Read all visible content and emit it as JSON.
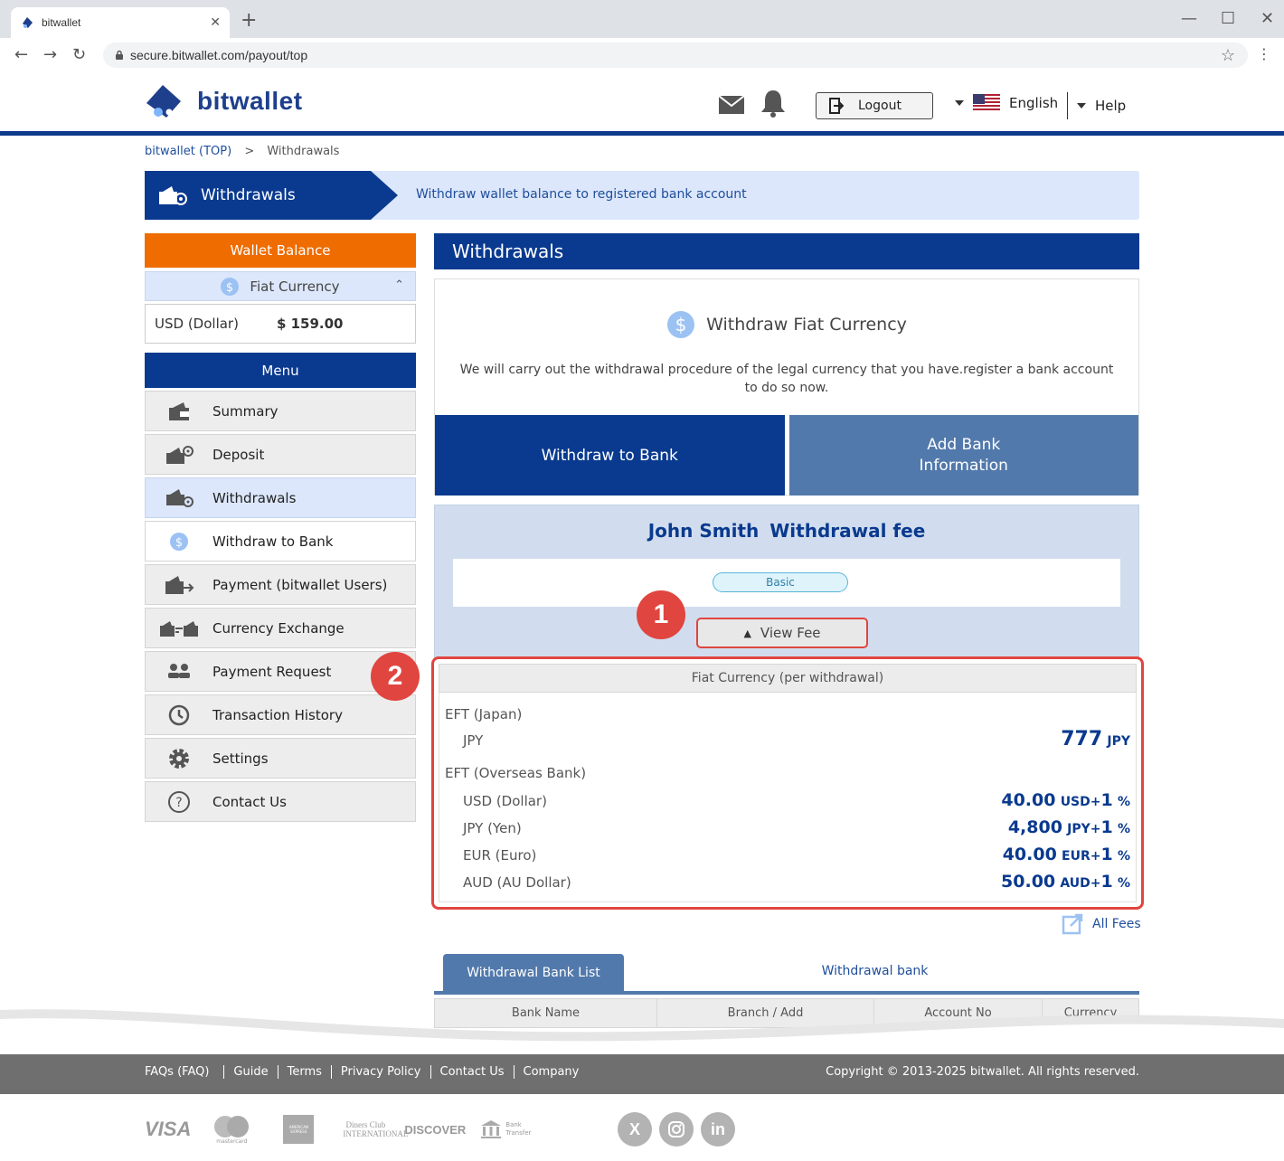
{
  "browser": {
    "tab_title": "bitwallet",
    "url": "secure.bitwallet.com/payout/top"
  },
  "header": {
    "logo_text": "bitwallet",
    "logout_label": "Logout",
    "language": "English",
    "help_label": "Help"
  },
  "breadcrumb": {
    "home": "bitwallet (TOP)",
    "separator": ">",
    "current": "Withdrawals"
  },
  "banner": {
    "label": "Withdrawals",
    "description": "Withdraw wallet balance to registered bank account"
  },
  "sidebar": {
    "wallet_balance_label": "Wallet Balance",
    "fiat_label": "Fiat Currency",
    "balance_currency": "USD (Dollar)",
    "balance_amount": "$ 159.00",
    "menu_label": "Menu",
    "items": [
      {
        "label": "Summary",
        "icon": "wallet-icon"
      },
      {
        "label": "Deposit",
        "icon": "deposit-icon"
      },
      {
        "label": "Withdrawals",
        "icon": "withdrawal-icon"
      },
      {
        "label": "Withdraw to Bank",
        "icon": "dollar-icon"
      },
      {
        "label": "Payment (bitwallet Users)",
        "icon": "payment-icon"
      },
      {
        "label": "Currency Exchange",
        "icon": "exchange-icon"
      },
      {
        "label": "Payment Request",
        "icon": "users-icon"
      },
      {
        "label": "Transaction History",
        "icon": "history-icon"
      },
      {
        "label": "Settings",
        "icon": "gear-icon"
      },
      {
        "label": "Contact Us",
        "icon": "question-icon"
      }
    ]
  },
  "main": {
    "title": "Withdrawals",
    "card_title": "Withdraw Fiat Currency",
    "card_desc": "We will carry out the withdrawal procedure of the legal currency that you have.register a bank account to do so now.",
    "btn_withdraw": "Withdraw to Bank",
    "btn_addbank_line1": "Add Bank",
    "btn_addbank_line2": "Information",
    "fee_user": "John Smith",
    "fee_title": "Withdrawal fee",
    "rank": "Basic",
    "view_fee": "View Fee",
    "callout_1": "1",
    "callout_2": "2"
  },
  "fees": {
    "header": "Fiat Currency (per withdrawal)",
    "eft_japan": "EFT (Japan)",
    "jpy_label": "JPY",
    "jpy_amount": "777",
    "jpy_unit": "JPY",
    "eft_overseas": "EFT (Overseas Bank)",
    "overseas": [
      {
        "label": "USD (Dollar)",
        "amount": "40.00",
        "unit": "USD+",
        "pct": "1",
        "pct_sign": "%"
      },
      {
        "label": "JPY (Yen)",
        "amount": "4,800",
        "unit": "JPY+",
        "pct": "1",
        "pct_sign": "%"
      },
      {
        "label": "EUR (Euro)",
        "amount": "40.00",
        "unit": "EUR+",
        "pct": "1",
        "pct_sign": "%"
      },
      {
        "label": "AUD (AU Dollar)",
        "amount": "50.00",
        "unit": "AUD+",
        "pct": "1",
        "pct_sign": "%"
      }
    ],
    "all_fees": "All Fees"
  },
  "bank_list": {
    "tab_active": "Withdrawal Bank List",
    "tab_other": "Withdrawal bank",
    "columns": [
      "Bank Name",
      "Branch / Add",
      "Account No",
      "Currency"
    ]
  },
  "footer": {
    "links": [
      "FAQs (FAQ)",
      "Guide",
      "Terms",
      "Privacy Policy",
      "Contact Us",
      "Company"
    ],
    "copyright": "Copyright © 2013-2025 bitwallet. All rights reserved.",
    "payment_logos": [
      "VISA",
      "mastercard",
      "AMERICAN EXPRESS",
      "Diners Club INTERNATIONAL",
      "DISCOVER",
      "Bank Transfer"
    ],
    "social": [
      "X",
      "Instagram",
      "in"
    ]
  },
  "colors": {
    "brand_navy": "#0a3a8f",
    "orange": "#ee6c00",
    "highlight_red": "#e0453f",
    "light_blue": "#dce7fb"
  }
}
